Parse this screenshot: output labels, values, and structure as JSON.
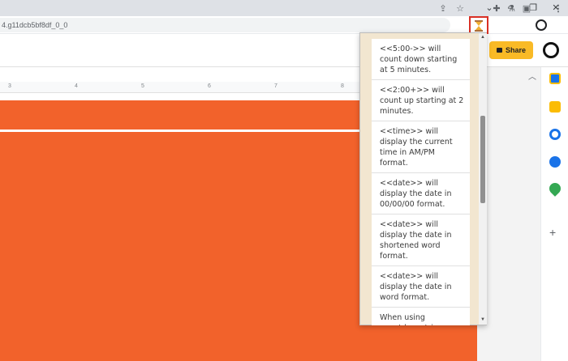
{
  "browser": {
    "url": "4.g11dcb5bf8df_0_0"
  },
  "app": {
    "share_label": "Share"
  },
  "ruler": {
    "ticks": [
      "3",
      "4",
      "5",
      "6",
      "7",
      "8"
    ]
  },
  "popup": {
    "items": [
      "<<5:00->> will count down starting at 5 minutes.",
      "<<2:00+>> will count up starting at 2 minutes.",
      "<<time>> will display the current time in AM/PM format.",
      "<<date>> will display the date in 00/00/00 format.",
      "<<date>> will display the date in shortened word format.",
      "<<date>> will display the date in word format.",
      "When using countdown trigger"
    ]
  },
  "colors": {
    "slide": "#f2622b",
    "share_button": "#f9ba26",
    "popup_bg": "#f2e6d0",
    "highlight": "#d93025"
  }
}
